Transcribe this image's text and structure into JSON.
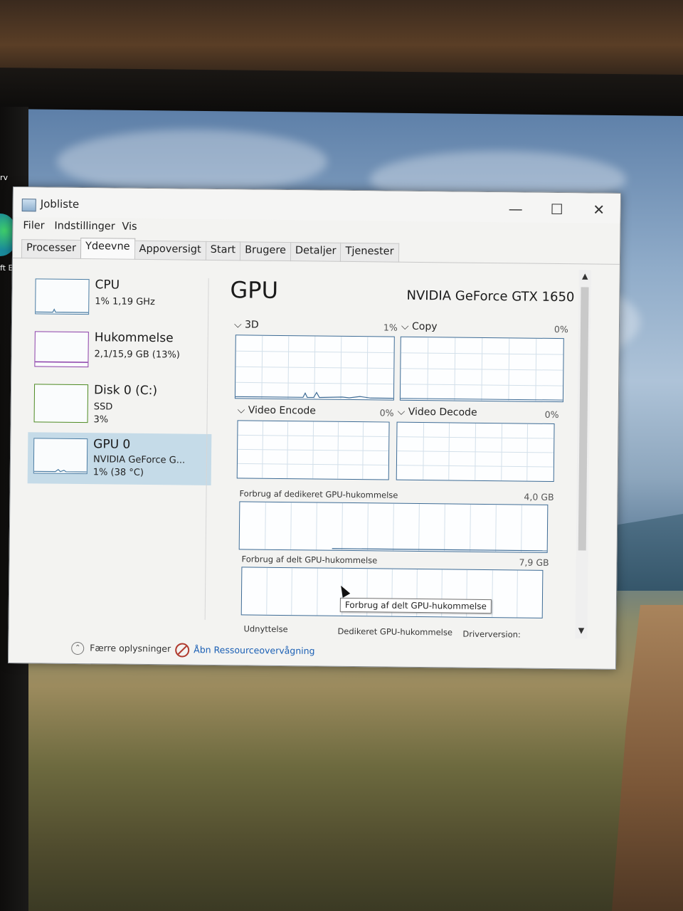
{
  "desktop": {
    "label_top": "rv",
    "label_mid": "ft Ec"
  },
  "window": {
    "title": "Jobliste",
    "controls": {
      "minimize": "—",
      "maximize": "☐",
      "close": "✕"
    }
  },
  "menu": {
    "items": [
      "Filer",
      "Indstillinger",
      "Vis"
    ]
  },
  "tabs": {
    "items": [
      "Processer",
      "Ydeevne",
      "Appoversigt",
      "Start",
      "Brugere",
      "Detaljer",
      "Tjenester"
    ],
    "active": "Ydeevne"
  },
  "sidebar": {
    "items": [
      {
        "name": "CPU",
        "line1": "1% 1,19 GHz",
        "line2": ""
      },
      {
        "name": "Hukommelse",
        "line1": "2,1/15,9 GB (13%)",
        "line2": ""
      },
      {
        "name": "Disk 0 (C:)",
        "line1": "SSD",
        "line2": "3%"
      },
      {
        "name": "GPU 0",
        "line1": "NVIDIA GeForce G...",
        "line2": "1% (38 °C)"
      }
    ],
    "selected": "GPU 0"
  },
  "main": {
    "title": "GPU",
    "model": "NVIDIA GeForce GTX 1650",
    "engines": [
      {
        "label": "3D",
        "value": "1%"
      },
      {
        "label": "Copy",
        "value": "0%"
      },
      {
        "label": "Video Encode",
        "value": "0%"
      },
      {
        "label": "Video Decode",
        "value": "0%"
      }
    ],
    "dedicated": {
      "label": "Forbrug af dedikeret GPU-hukommelse",
      "max": "4,0 GB"
    },
    "shared": {
      "label": "Forbrug af delt GPU-hukommelse",
      "max": "7,9 GB"
    },
    "bottom_labels": [
      "Udnyttelse",
      "Dedikeret GPU-hukommelse",
      "Driverversion:"
    ]
  },
  "tooltip": "Forbrug af delt GPU-hukommelse",
  "footer": {
    "fewer_details": "Færre oplysninger",
    "resource_monitor": "Åbn Ressourceovervågning"
  },
  "colors": {
    "cpu_border": "#4a7ca3",
    "memory_border": "#8b3ea8",
    "disk_border": "#4d8a22",
    "gpu_graph_border": "#3d6b95",
    "selected_bg": "#c5dbe8",
    "link": "#1a5fb4"
  },
  "icons": {
    "app": "task-manager-icon",
    "fewer_details": "chevron-up-circle-icon",
    "resource_monitor": "resource-monitor-icon"
  }
}
